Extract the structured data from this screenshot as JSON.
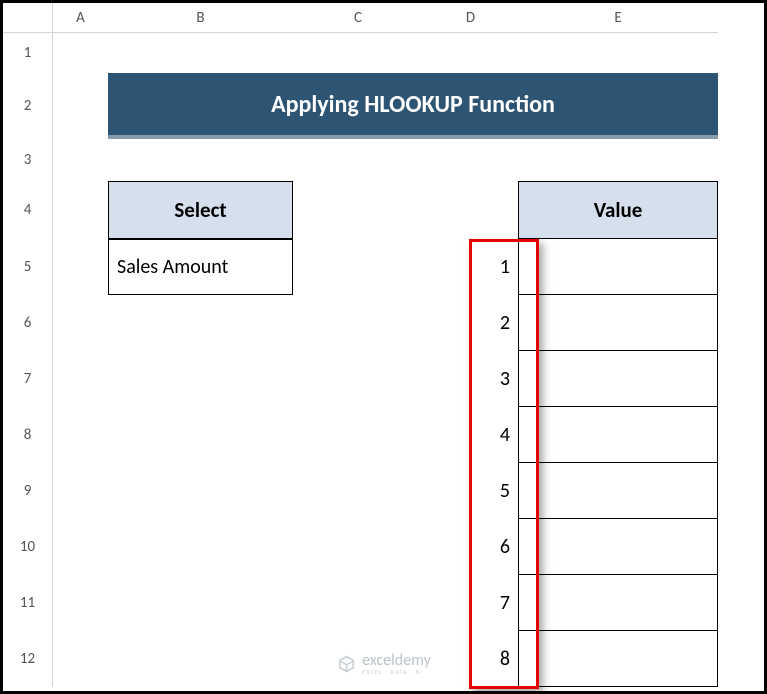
{
  "columns": [
    "A",
    "B",
    "C",
    "D",
    "E"
  ],
  "rows": [
    "1",
    "2",
    "3",
    "4",
    "5",
    "6",
    "7",
    "8",
    "9",
    "10",
    "11",
    "12"
  ],
  "title": "Applying HLOOKUP Function",
  "select": {
    "header": "Select",
    "value": "Sales Amount"
  },
  "value": {
    "header": "Value"
  },
  "numbers": [
    "1",
    "2",
    "3",
    "4",
    "5",
    "6",
    "7",
    "8"
  ],
  "watermark": {
    "main": "exceldemy",
    "sub": "EXCEL · DATA · BI"
  },
  "chart_data": {
    "type": "table",
    "title": "Applying HLOOKUP Function",
    "select_header": "Select",
    "select_value": "Sales Amount",
    "value_header": "Value",
    "value_cells": [
      "",
      "",
      "",
      "",
      "",
      "",
      "",
      ""
    ],
    "index_column_D": [
      1,
      2,
      3,
      4,
      5,
      6,
      7,
      8
    ]
  }
}
